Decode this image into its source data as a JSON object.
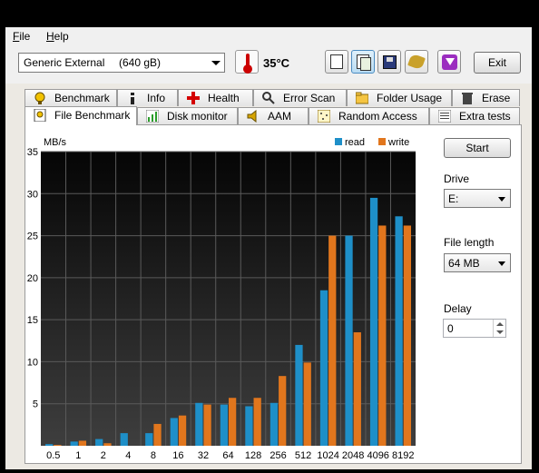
{
  "menu": {
    "file_u": "F",
    "file_rest": "ile",
    "help_u": "H",
    "help_rest": "elp"
  },
  "toolbar": {
    "drive_name": "Generic External",
    "drive_size": "(640 gB)",
    "temperature": "35°C",
    "exit_label": "Exit",
    "icons": [
      "copy-text-icon",
      "copy-screenshot-icon",
      "save-icon",
      "options-icon",
      "download-icon"
    ]
  },
  "tabs_row1": [
    "Benchmark",
    "Info",
    "Health",
    "Error Scan",
    "Folder Usage",
    "Erase"
  ],
  "tabs_row2": [
    "File Benchmark",
    "Disk monitor",
    "AAM",
    "Random Access",
    "Extra tests"
  ],
  "side": {
    "start_label": "Start",
    "drive_label": "Drive",
    "drive_value": "E:",
    "file_length_label": "File length",
    "file_length_value": "64 MB",
    "delay_label": "Delay",
    "delay_value": "0"
  },
  "colors": {
    "read": "#1e8fc8",
    "write": "#e1761d"
  },
  "chart_data": {
    "type": "bar",
    "ylabel": "MB/s",
    "ylim": [
      0,
      35
    ],
    "yticks": [
      5,
      10,
      15,
      20,
      25,
      30,
      35
    ],
    "categories": [
      "0.5",
      "1",
      "2",
      "4",
      "8",
      "16",
      "32",
      "64",
      "128",
      "256",
      "512",
      "1024",
      "2048",
      "4096",
      "8192"
    ],
    "legend_position": "top-right",
    "series": [
      {
        "name": "read",
        "values": [
          0.2,
          0.5,
          0.8,
          1.5,
          1.5,
          3.3,
          5.1,
          4.9,
          4.7,
          5.1,
          12.0,
          18.5,
          25.0,
          29.5,
          27.3
        ]
      },
      {
        "name": "write",
        "values": [
          0.1,
          0.6,
          0.3,
          0.0,
          2.6,
          3.6,
          4.9,
          5.7,
          5.7,
          8.3,
          9.9,
          25.0,
          13.5,
          26.2,
          26.2
        ]
      }
    ]
  }
}
